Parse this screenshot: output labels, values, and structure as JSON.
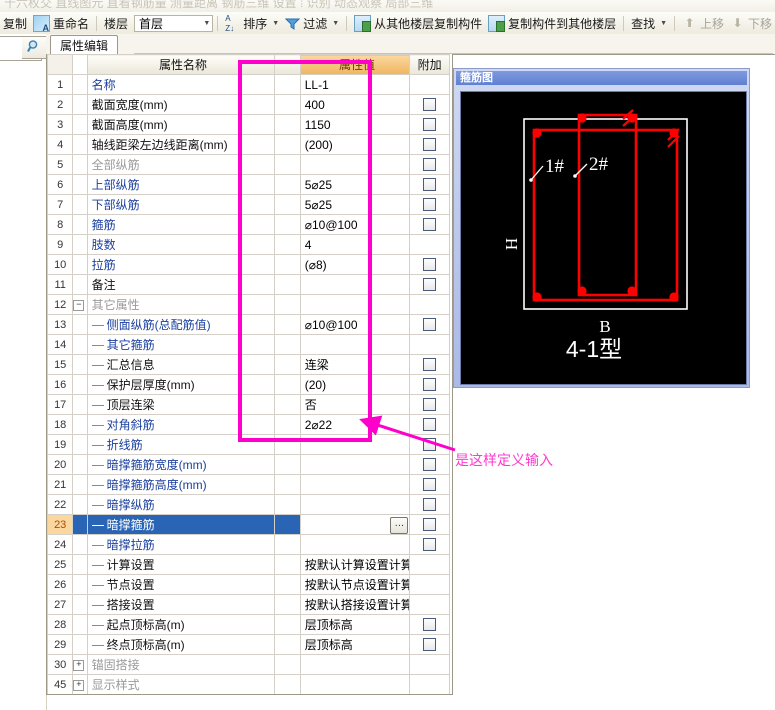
{
  "top_ghost_toolbar": {
    "text": "十六枚交 直线图元 直看钢筋量 测量距离 钢筋三维 设置  ⁞ 识别 动态观察 局部三维"
  },
  "toolbar": {
    "items": [
      {
        "label": "复制",
        "icon": "copy-icon",
        "disabled": false
      },
      {
        "label": "重命名",
        "icon": "rename-icon",
        "disabled": false
      },
      {
        "label": "楼层",
        "icon": null,
        "disabled": false
      },
      {
        "label": "排序",
        "icon": "sort-icon",
        "caret": true,
        "disabled": false
      },
      {
        "label": "过滤",
        "icon": "filter-icon",
        "caret": true,
        "disabled": false
      },
      {
        "label": "从其他楼层复制构件",
        "icon": "copy-from-floor-icon",
        "disabled": false
      },
      {
        "label": "复制构件到其他楼层",
        "icon": "copy-to-floor-icon",
        "disabled": false
      },
      {
        "label": "查找",
        "icon": null,
        "caret": true,
        "disabled": false
      },
      {
        "label": "上移",
        "icon": "arrow-up-icon",
        "disabled": true
      },
      {
        "label": "下移",
        "icon": "arrow-down-icon",
        "disabled": true
      }
    ],
    "floor_combo_value": "首层"
  },
  "search": {
    "value": "",
    "placeholder": "",
    "icon": "search-icon"
  },
  "tabs": [
    {
      "label": "属性编辑",
      "active": true
    }
  ],
  "grid": {
    "headers": {
      "index": "",
      "name": "属性名称",
      "value": "属性值",
      "additional": "附加"
    },
    "rows": [
      {
        "num": "1",
        "name": "名称",
        "value": "LL-1",
        "style": "link",
        "indent": 0,
        "tree": "",
        "check": false,
        "selected": false
      },
      {
        "num": "2",
        "name": "截面宽度(mm)",
        "value": "400",
        "style": "plain",
        "indent": 0,
        "tree": "",
        "check": true,
        "selected": false
      },
      {
        "num": "3",
        "name": "截面高度(mm)",
        "value": "1150",
        "style": "plain",
        "indent": 0,
        "tree": "",
        "check": true,
        "selected": false
      },
      {
        "num": "4",
        "name": "轴线距梁左边线距离(mm)",
        "value": "(200)",
        "style": "plain",
        "indent": 0,
        "tree": "",
        "check": true,
        "selected": false
      },
      {
        "num": "5",
        "name": "全部纵筋",
        "value": "",
        "style": "gray",
        "indent": 0,
        "tree": "",
        "check": true,
        "selected": false
      },
      {
        "num": "6",
        "name": "上部纵筋",
        "value": "5⌀25",
        "style": "link",
        "indent": 0,
        "tree": "",
        "check": true,
        "selected": false
      },
      {
        "num": "7",
        "name": "下部纵筋",
        "value": "5⌀25",
        "style": "link",
        "indent": 0,
        "tree": "",
        "check": true,
        "selected": false
      },
      {
        "num": "8",
        "name": "箍筋",
        "value": "⌀10@100",
        "style": "link",
        "indent": 0,
        "tree": "",
        "check": true,
        "selected": false
      },
      {
        "num": "9",
        "name": "肢数",
        "value": "4",
        "style": "link",
        "indent": 0,
        "tree": "",
        "check": false,
        "selected": false
      },
      {
        "num": "10",
        "name": "拉筋",
        "value": "(⌀8)",
        "style": "link",
        "indent": 0,
        "tree": "",
        "check": true,
        "selected": false
      },
      {
        "num": "11",
        "name": "备注",
        "value": "",
        "style": "plain",
        "indent": 0,
        "tree": "",
        "check": true,
        "selected": false
      },
      {
        "num": "12",
        "name": "其它属性",
        "value": "",
        "style": "gray",
        "indent": 0,
        "tree": "minus",
        "check": false,
        "selected": false
      },
      {
        "num": "13",
        "name": "侧面纵筋(总配筋值)",
        "value": "⌀10@100",
        "style": "link",
        "indent": 1,
        "tree": "dash",
        "check": true,
        "selected": false
      },
      {
        "num": "14",
        "name": "其它箍筋",
        "value": "",
        "style": "link",
        "indent": 1,
        "tree": "dash",
        "check": false,
        "selected": false
      },
      {
        "num": "15",
        "name": "汇总信息",
        "value": "连梁",
        "style": "plain",
        "indent": 1,
        "tree": "dash",
        "check": true,
        "selected": false
      },
      {
        "num": "16",
        "name": "保护层厚度(mm)",
        "value": "(20)",
        "style": "plain",
        "indent": 1,
        "tree": "dash",
        "check": true,
        "selected": false
      },
      {
        "num": "17",
        "name": "顶层连梁",
        "value": "否",
        "style": "plain",
        "indent": 1,
        "tree": "dash",
        "check": true,
        "selected": false
      },
      {
        "num": "18",
        "name": "对角斜筋",
        "value": "2⌀22",
        "style": "link",
        "indent": 1,
        "tree": "dash",
        "check": true,
        "selected": false
      },
      {
        "num": "19",
        "name": "折线筋",
        "value": "",
        "style": "link",
        "indent": 1,
        "tree": "dash",
        "check": true,
        "selected": false
      },
      {
        "num": "20",
        "name": "暗撑箍筋宽度(mm)",
        "value": "",
        "style": "link",
        "indent": 1,
        "tree": "dash",
        "check": true,
        "selected": false
      },
      {
        "num": "21",
        "name": "暗撑箍筋高度(mm)",
        "value": "",
        "style": "link",
        "indent": 1,
        "tree": "dash",
        "check": true,
        "selected": false
      },
      {
        "num": "22",
        "name": "暗撑纵筋",
        "value": "",
        "style": "link",
        "indent": 1,
        "tree": "dash",
        "check": true,
        "selected": false
      },
      {
        "num": "23",
        "name": "暗撑箍筋",
        "value": "",
        "style": "link",
        "indent": 1,
        "tree": "dash",
        "check": true,
        "selected": true,
        "ellipsis": "…"
      },
      {
        "num": "24",
        "name": "暗撑拉筋",
        "value": "",
        "style": "link",
        "indent": 1,
        "tree": "dash",
        "check": true,
        "selected": false
      },
      {
        "num": "25",
        "name": "计算设置",
        "value": "按默认计算设置计算",
        "style": "plain",
        "indent": 1,
        "tree": "dash",
        "check": false,
        "selected": false
      },
      {
        "num": "26",
        "name": "节点设置",
        "value": "按默认节点设置计算",
        "style": "plain",
        "indent": 1,
        "tree": "dash",
        "check": false,
        "selected": false
      },
      {
        "num": "27",
        "name": "搭接设置",
        "value": "按默认搭接设置计算",
        "style": "plain",
        "indent": 1,
        "tree": "dash",
        "check": false,
        "selected": false
      },
      {
        "num": "28",
        "name": "起点顶标高(m)",
        "value": "层顶标高",
        "style": "plain",
        "indent": 1,
        "tree": "dash",
        "check": true,
        "selected": false
      },
      {
        "num": "29",
        "name": "终点顶标高(m)",
        "value": "层顶标高",
        "style": "plain",
        "indent": 1,
        "tree": "last",
        "check": true,
        "selected": false
      },
      {
        "num": "30",
        "name": "锚固搭接",
        "value": "",
        "style": "gray",
        "indent": 0,
        "tree": "plus",
        "check": false,
        "selected": false
      },
      {
        "num": "45",
        "name": "显示样式",
        "value": "",
        "style": "gray",
        "indent": 0,
        "tree": "plus",
        "check": false,
        "selected": false
      }
    ]
  },
  "annotation": {
    "text": "是这样定义输入",
    "color": "#ff3ad0"
  },
  "diagram": {
    "title": "箍筋图",
    "caption": "4-1型",
    "label_h": "H",
    "label_b": "B",
    "callout_1": "1#",
    "callout_2": "2#",
    "bar_color": "#ff0000",
    "outline_color": "#ffffff",
    "background": "#000000"
  }
}
